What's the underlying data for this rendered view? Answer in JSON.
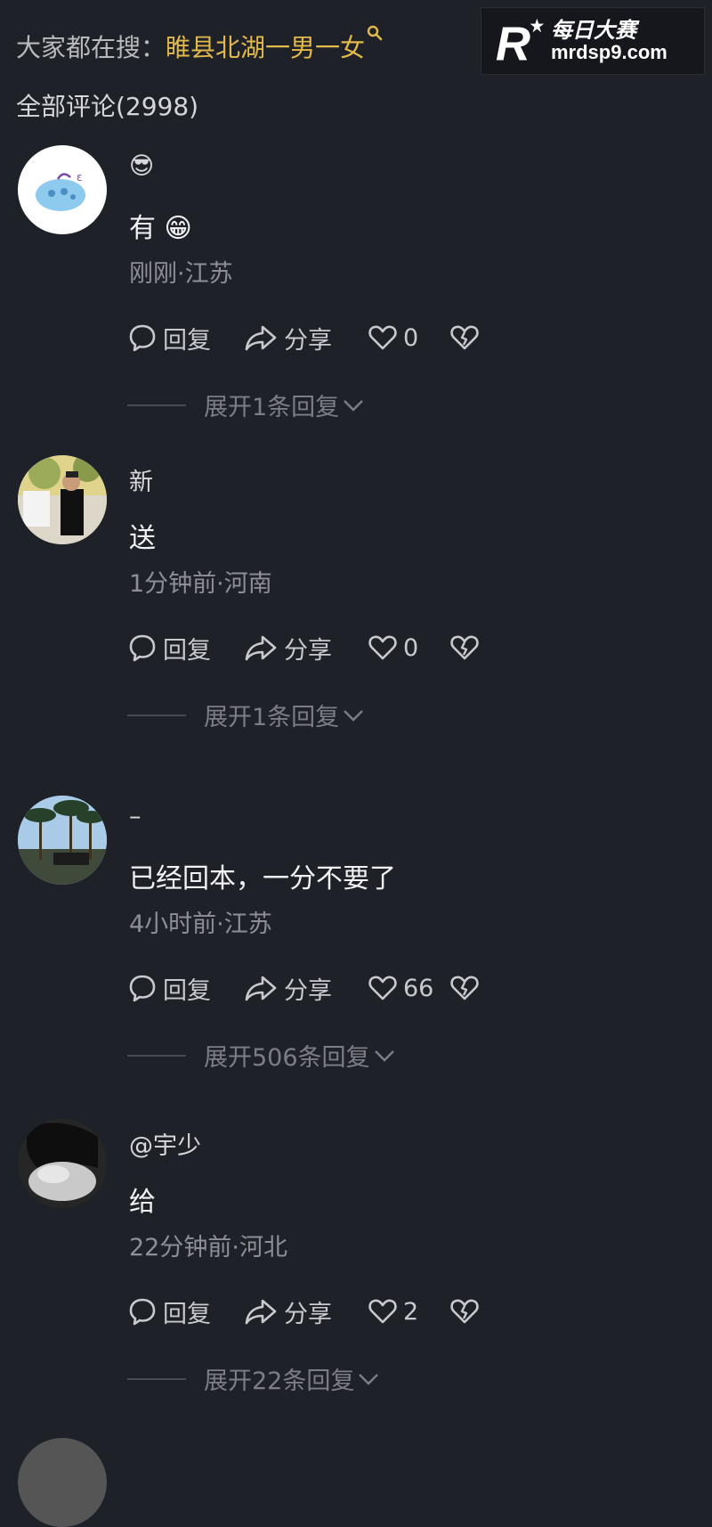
{
  "watermark": {
    "cn_text": "每日大赛",
    "url": "mrdsp9.com"
  },
  "search_bar": {
    "prefix": "大家都在搜：",
    "term": "睢县北湖一男一女"
  },
  "comments_header": {
    "title": "全部评论(2998)"
  },
  "actions": {
    "reply_label": "回复",
    "share_label": "分享"
  },
  "comments": [
    {
      "username": "😎",
      "text": "有 😁",
      "meta": "刚刚·江苏",
      "likes": "0",
      "expand_label": "展开1条回复"
    },
    {
      "username": "新",
      "text": "送",
      "meta": "1分钟前·河南",
      "likes": "0",
      "expand_label": "展开1条回复"
    },
    {
      "username": "–",
      "text": "已经回本，一分不要了",
      "meta": "4小时前·江苏",
      "likes": "66",
      "expand_label": "展开506条回复"
    },
    {
      "username": "@宇少",
      "text": "给",
      "meta": "22分钟前·河北",
      "likes": "2",
      "expand_label": "展开22条回复"
    }
  ],
  "colors": {
    "background": "#1f2129",
    "search_highlight": "#e3b94c"
  }
}
